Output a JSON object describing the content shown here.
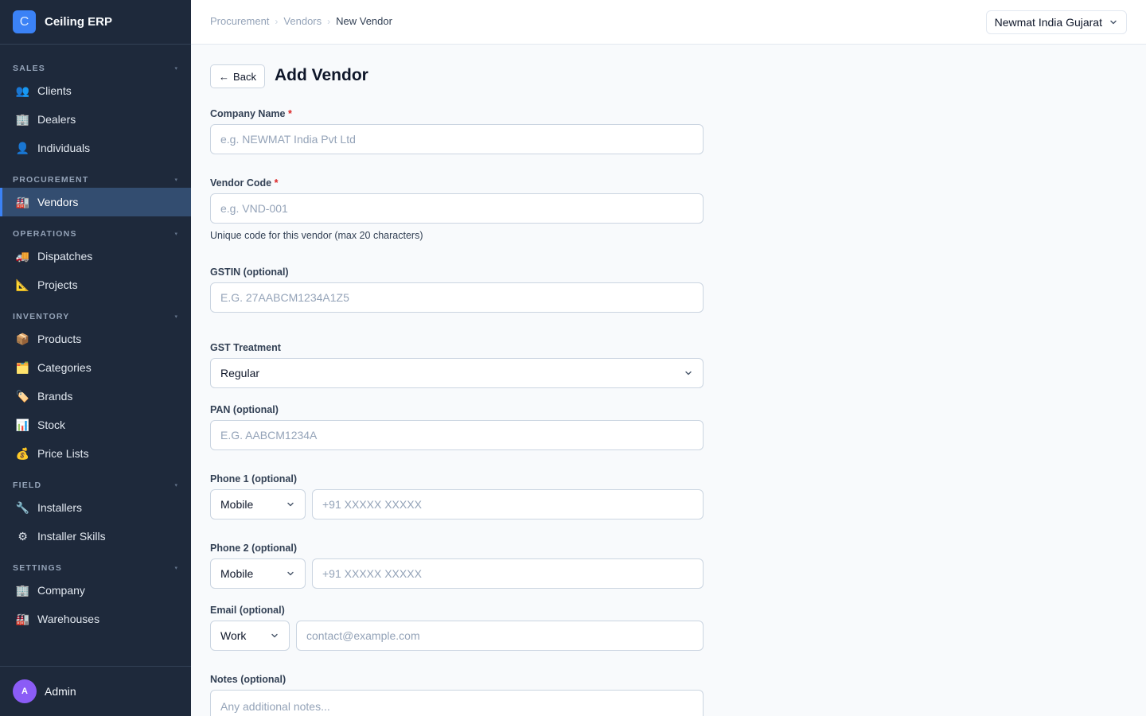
{
  "app": {
    "logo_letter": "C",
    "name": "Ceiling ERP"
  },
  "sidebar": {
    "sections": [
      {
        "title": "SALES",
        "items": [
          {
            "icon": "👥",
            "label": "Clients"
          },
          {
            "icon": "🏢",
            "label": "Dealers"
          },
          {
            "icon": "👤",
            "label": "Individuals"
          }
        ]
      },
      {
        "title": "PROCUREMENT",
        "items": [
          {
            "icon": "🏭",
            "label": "Vendors",
            "active": true
          }
        ]
      },
      {
        "title": "OPERATIONS",
        "items": [
          {
            "icon": "🚚",
            "label": "Dispatches"
          },
          {
            "icon": "📐",
            "label": "Projects"
          }
        ]
      },
      {
        "title": "INVENTORY",
        "items": [
          {
            "icon": "📦",
            "label": "Products"
          },
          {
            "icon": "🗂️",
            "label": "Categories"
          },
          {
            "icon": "🏷️",
            "label": "Brands"
          },
          {
            "icon": "📊",
            "label": "Stock"
          },
          {
            "icon": "💰",
            "label": "Price Lists"
          }
        ]
      },
      {
        "title": "FIELD",
        "items": [
          {
            "icon": "🔧",
            "label": "Installers"
          },
          {
            "icon": "⚙",
            "label": "Installer Skills"
          }
        ]
      },
      {
        "title": "SETTINGS",
        "items": [
          {
            "icon": "🏢",
            "label": "Company"
          },
          {
            "icon": "🏭",
            "label": "Warehouses"
          }
        ]
      }
    ],
    "section_toggle": "▾",
    "user": {
      "avatar_letter": "A",
      "name": "Admin"
    }
  },
  "header": {
    "breadcrumb": [
      "Procurement",
      "Vendors",
      "New Vendor"
    ],
    "breadcrumb_sep": "›",
    "company": "Newmat India Gujarat"
  },
  "page": {
    "back_label": "Back",
    "back_arrow": "←",
    "title": "Add Vendor"
  },
  "form": {
    "company_name": {
      "label": "Company Name",
      "required_mark": "*",
      "placeholder": "e.g. NEWMAT India Pvt Ltd"
    },
    "vendor_code": {
      "label": "Vendor Code",
      "required_mark": "*",
      "placeholder": "e.g. VND-001",
      "help": "Unique code for this vendor (max 20 characters)"
    },
    "gstin": {
      "label": "GSTIN (optional)",
      "placeholder": "E.G. 27AABCM1234A1Z5"
    },
    "gst_treatment": {
      "label": "GST Treatment",
      "value": "Regular"
    },
    "pan": {
      "label": "PAN (optional)",
      "placeholder": "E.G. AABCM1234A"
    },
    "phone1": {
      "label": "Phone 1 (optional)",
      "type": "Mobile",
      "placeholder": "+91 XXXXX XXXXX"
    },
    "phone2": {
      "label": "Phone 2 (optional)",
      "type": "Mobile",
      "placeholder": "+91 XXXXX XXXXX"
    },
    "email": {
      "label": "Email (optional)",
      "type": "Work",
      "placeholder": "contact@example.com"
    },
    "notes": {
      "label": "Notes (optional)",
      "placeholder": "Any additional notes..."
    }
  }
}
